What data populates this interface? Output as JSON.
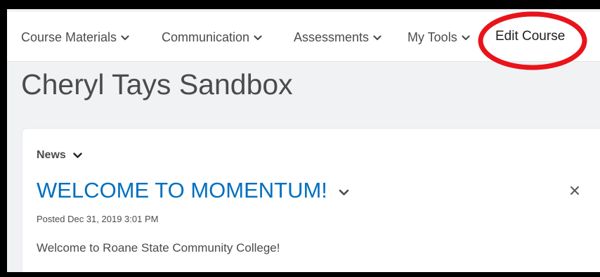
{
  "nav": {
    "items": [
      {
        "label": "Course Materials",
        "icon": "chevron-down-icon"
      },
      {
        "label": "Communication",
        "icon": "chevron-down-icon"
      },
      {
        "label": "Assessments",
        "icon": "chevron-down-icon"
      },
      {
        "label": "My Tools",
        "icon": "chevron-down-icon"
      }
    ],
    "edit_course": "Edit Course",
    "highlight_color": "#e8141a"
  },
  "page": {
    "title": "Cheryl Tays Sandbox"
  },
  "news_widget": {
    "header": "News",
    "item": {
      "title": "WELCOME TO MOMENTUM!",
      "posted": "Posted Dec 31, 2019 3:01 PM",
      "body": "Welcome to Roane State Community College!"
    },
    "link_color": "#006fbf"
  }
}
